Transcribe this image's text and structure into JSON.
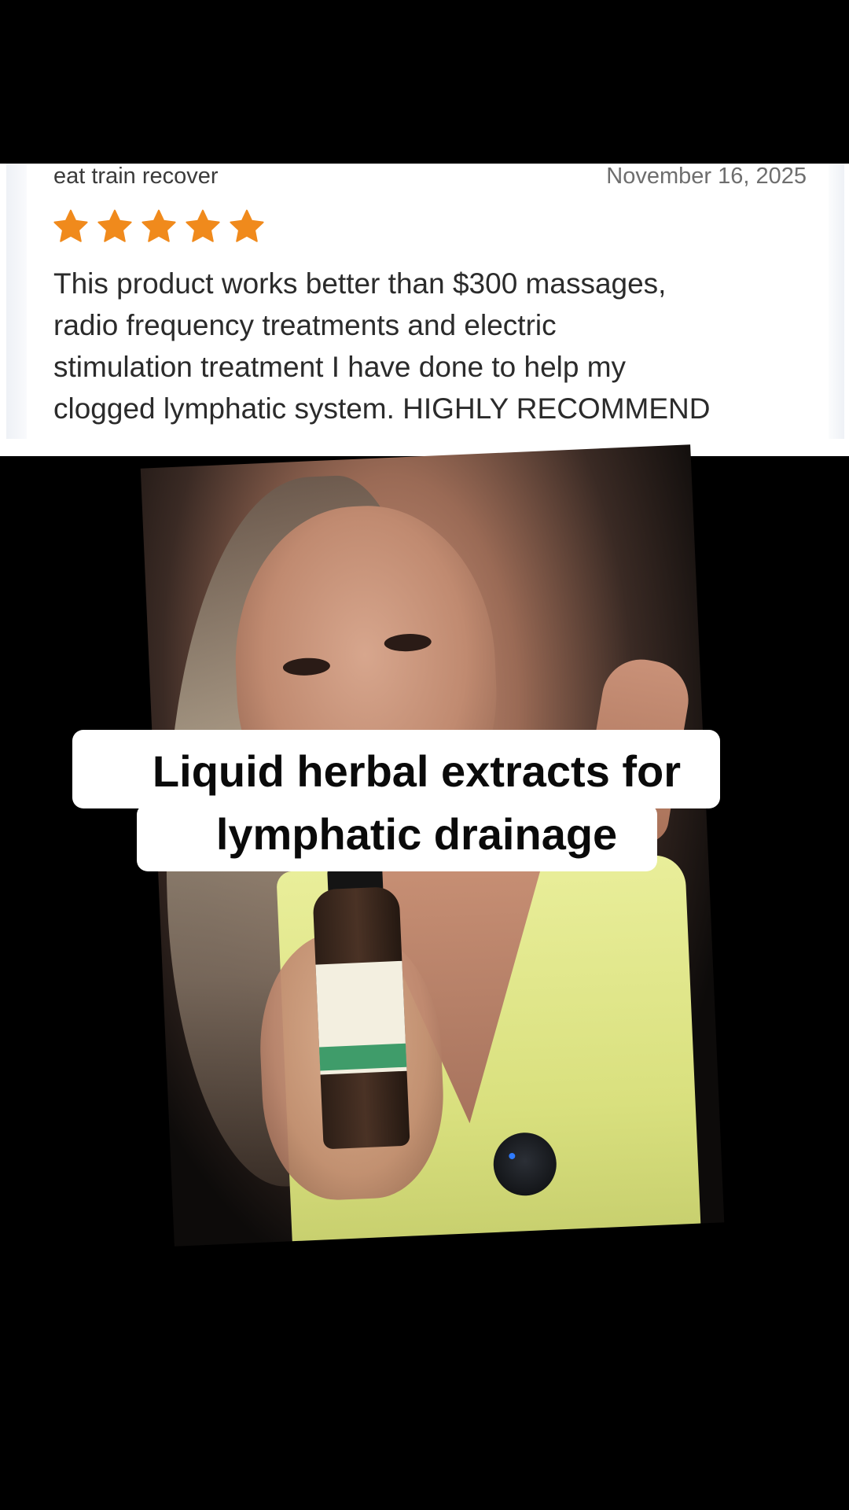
{
  "review": {
    "author": "eat train recover",
    "date": "November 16, 2025",
    "rating": 5,
    "rating_max": 5,
    "star_color": "#f08a1c",
    "text": "This product works better than $300 massages,\nradio frequency treatments and electric\nstimulation treatment I have done to help my\nclogged lymphatic system. HIGHLY RECOMMEND"
  },
  "caption": {
    "line1": "Liquid herbal extracts for",
    "line2": "lymphatic drainage"
  },
  "icons": {
    "star": "star-icon"
  }
}
